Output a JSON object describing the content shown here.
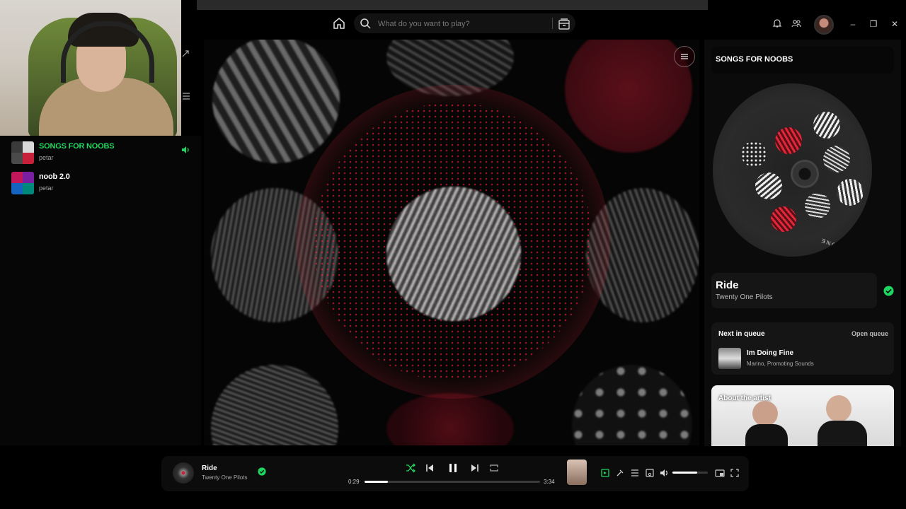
{
  "search": {
    "placeholder": "What do you want to play?"
  },
  "sidebar": {
    "playlists": [
      {
        "title": "SONGS FOR NOOBS",
        "owner": "petar",
        "playing": true
      },
      {
        "title": "noob 2.0",
        "owner": "petar",
        "playing": false
      }
    ]
  },
  "right_panel": {
    "playlist_title": "SONGS FOR NOOBS",
    "album_text": "TWENTY ONE PILOTS",
    "now_playing": {
      "title": "Ride",
      "artist": "Twenty One Pilots"
    },
    "queue": {
      "heading": "Next in queue",
      "open_label": "Open queue",
      "next": {
        "title": "Im Doing Fine",
        "artist": "Marino, Promoting Sounds"
      }
    },
    "about": {
      "heading": "About the artist"
    }
  },
  "player": {
    "title": "Ride",
    "artist": "Twenty One Pilots",
    "elapsed": "0:29",
    "duration": "3:34",
    "progress": 0.135,
    "volume": 0.7
  },
  "colors": {
    "accent": "#1ed760",
    "viz_red": "#ff2b3f",
    "bg": "#000000"
  },
  "icons": [
    "home-icon",
    "search-icon",
    "browse-icon",
    "bell-icon",
    "friends-icon",
    "minimize-icon",
    "maximize-icon",
    "close-icon",
    "menu-icon",
    "shuffle-icon",
    "previous-icon",
    "pause-icon",
    "next-icon",
    "repeat-icon",
    "check-icon",
    "speaker-icon"
  ]
}
